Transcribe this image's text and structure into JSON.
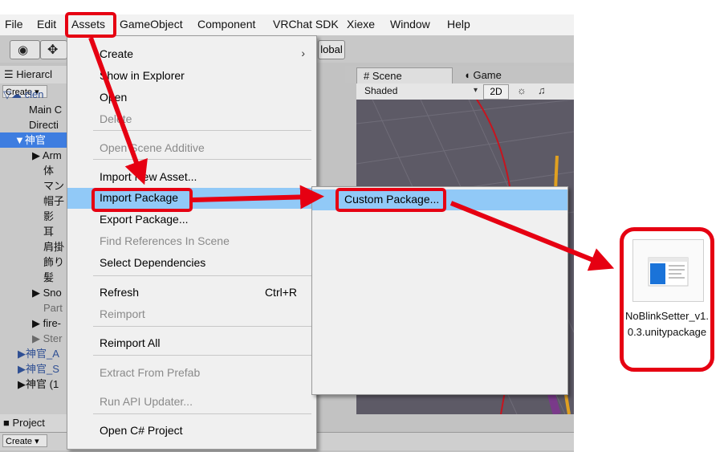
{
  "menubar": {
    "items": [
      "File",
      "Edit",
      "Assets",
      "GameObject",
      "Component",
      "VRChat SDK",
      "Xiexe",
      "Window",
      "Help"
    ]
  },
  "toolbar": {
    "global_label": "lobal"
  },
  "hierarchy": {
    "tab_label": "☰ Hierarcl",
    "create_label": "Create ▾",
    "rows": [
      "▽☁ clen",
      "Main C",
      "Directi",
      "▼神官",
      "▶ Arm",
      "体",
      "マン",
      "帽子",
      "影",
      "耳",
      "肩掛",
      "飾り",
      "髪",
      "▶ Sno",
      "Part",
      "▶ fire-",
      "▶ Ster",
      "▶神官_A",
      "▶神官_S",
      "▶神官 (1"
    ]
  },
  "project": {
    "tab_label": "■ Project",
    "create_label": "Create ▾"
  },
  "scene": {
    "tab_scene": "# Scene",
    "tab_game": "◖ Game",
    "shading": "Shaded",
    "mode_2d": "2D"
  },
  "assets_menu": {
    "items": [
      {
        "label": "Create",
        "shortcut": "",
        "submenu": true,
        "disabled": false
      },
      {
        "label": "Show in Explorer",
        "shortcut": "",
        "submenu": false,
        "disabled": false
      },
      {
        "label": "Open",
        "shortcut": "",
        "submenu": false,
        "disabled": false
      },
      {
        "label": "Delete",
        "shortcut": "",
        "submenu": false,
        "disabled": true
      },
      {
        "label": "Open Scene Additive",
        "shortcut": "",
        "submenu": false,
        "disabled": true
      },
      {
        "label": "Import New Asset...",
        "shortcut": "",
        "submenu": false,
        "disabled": false
      },
      {
        "label": "Import Package",
        "shortcut": "",
        "submenu": true,
        "disabled": false
      },
      {
        "label": "Export Package...",
        "shortcut": "",
        "submenu": false,
        "disabled": false
      },
      {
        "label": "Find References In Scene",
        "shortcut": "",
        "submenu": false,
        "disabled": true
      },
      {
        "label": "Select Dependencies",
        "shortcut": "",
        "submenu": false,
        "disabled": false
      },
      {
        "label": "Refresh",
        "shortcut": "Ctrl+R",
        "submenu": false,
        "disabled": false
      },
      {
        "label": "Reimport",
        "shortcut": "",
        "submenu": false,
        "disabled": true
      },
      {
        "label": "Reimport All",
        "shortcut": "",
        "submenu": false,
        "disabled": false
      },
      {
        "label": "Extract From Prefab",
        "shortcut": "",
        "submenu": false,
        "disabled": true
      },
      {
        "label": "Run API Updater...",
        "shortcut": "",
        "submenu": false,
        "disabled": true
      },
      {
        "label": "Open C# Project",
        "shortcut": "",
        "submenu": false,
        "disabled": false
      }
    ]
  },
  "import_submenu": {
    "items": [
      "Custom Package..."
    ]
  },
  "file": {
    "name": "NoBlinkSetter_v1.0.3.unitypackage"
  },
  "colors": {
    "highlight": "#e60012",
    "menu_hover": "#91c9f7",
    "selection": "#3e7de0"
  }
}
